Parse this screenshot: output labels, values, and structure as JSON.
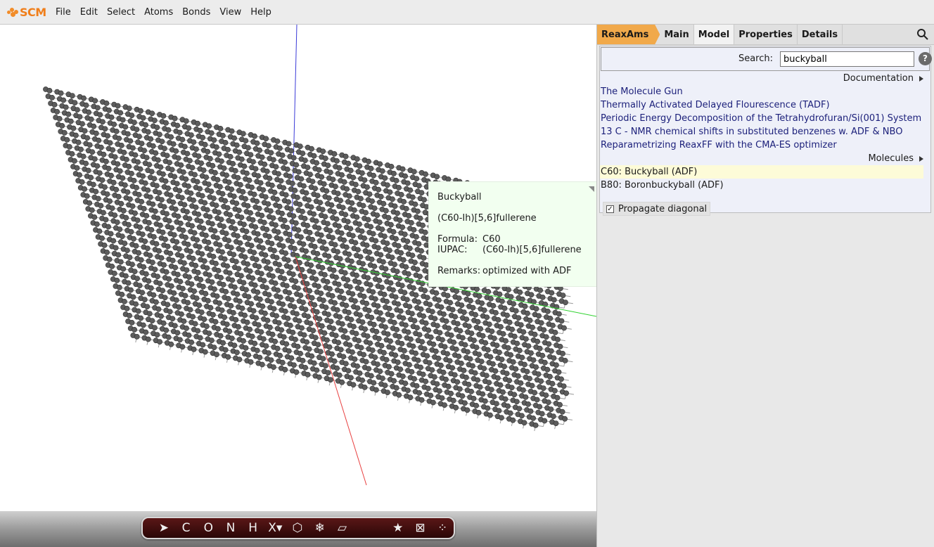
{
  "app": {
    "logo_text": "SCM"
  },
  "menu": [
    "File",
    "Edit",
    "Select",
    "Atoms",
    "Bonds",
    "View",
    "Help"
  ],
  "tabs": [
    {
      "label": "ReaxAms",
      "active": false,
      "accent": "#f1a94a"
    },
    {
      "label": "Main",
      "active": false
    },
    {
      "label": "Model",
      "active": true
    },
    {
      "label": "Properties",
      "active": false
    },
    {
      "label": "Details",
      "active": false
    }
  ],
  "search": {
    "label": "Search:",
    "value": "buckyball",
    "help": "?"
  },
  "documentation": {
    "heading": "Documentation",
    "items": [
      "The Molecule Gun",
      "Thermally Activated Delayed Flourescence (TADF)",
      "Periodic Energy Decomposition of the Tetrahydrofuran/Si(001) System",
      "13 C - NMR chemical shifts in substituted benzenes w. ADF & NBO",
      "Reparametrizing ReaxFF with the CMA-ES optimizer"
    ]
  },
  "molecules": {
    "heading": "Molecules",
    "items": [
      {
        "label": "C60: Buckyball (ADF)",
        "highlighted": true
      },
      {
        "label": "B80: Boronbuckyball (ADF)",
        "highlighted": false
      }
    ]
  },
  "propagate": {
    "label": "Propagate diagonal",
    "checked": true
  },
  "tooltip": {
    "title": "Buckyball",
    "subtitle": "(C60-Ih)[5,6]fullerene",
    "formula_key": "Formula:",
    "formula_val": "C60",
    "iupac_key": "IUPAC:",
    "iupac_val": "(C60-Ih)[5,6]fullerene",
    "remarks_key": "Remarks:",
    "remarks_val": "optimized with ADF"
  },
  "toolbar": {
    "tools": [
      {
        "name": "select-arrow-icon",
        "glyph": "➤"
      },
      {
        "name": "carbon-tool",
        "glyph": "C"
      },
      {
        "name": "oxygen-tool",
        "glyph": "O"
      },
      {
        "name": "nitrogen-tool",
        "glyph": "N"
      },
      {
        "name": "hydrogen-tool",
        "glyph": "H"
      },
      {
        "name": "other-element-tool",
        "glyph": "X▾"
      },
      {
        "name": "ring-icon",
        "glyph": "⬡"
      },
      {
        "name": "snowflake-icon",
        "glyph": "❄"
      },
      {
        "name": "plane-icon",
        "glyph": "▱"
      }
    ],
    "right_tools": [
      {
        "name": "star-icon",
        "glyph": "★"
      },
      {
        "name": "crystal-icon",
        "glyph": "⊠"
      },
      {
        "name": "cluster-icon",
        "glyph": "⁘"
      }
    ]
  },
  "colors": {
    "accent": "#f1a94a",
    "link": "#1b1f7a",
    "highlight": "#fdfbd8",
    "tooltip_bg": "#f2fff0"
  }
}
